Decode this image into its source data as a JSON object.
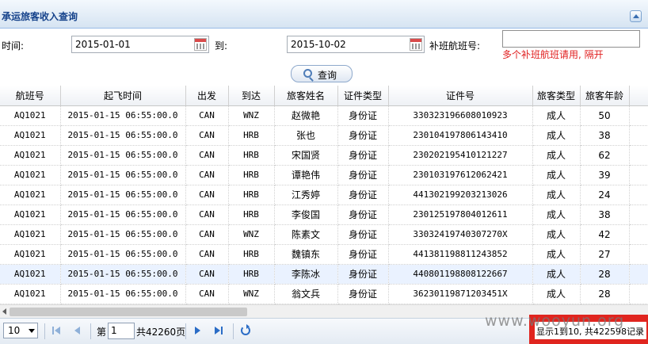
{
  "panel": {
    "title": "承运旅客收入查询"
  },
  "form": {
    "time_label": "时间:",
    "start_date": "2015-01-01",
    "to_label": "到:",
    "end_date": "2015-10-02",
    "supplement_label": "补班航班号:",
    "supplement_value": "",
    "hint": "多个补班航班请用, 隔开",
    "query_label": "查询"
  },
  "table": {
    "columns": [
      "航班号",
      "起飞时间",
      "出发",
      "到达",
      "旅客姓名",
      "证件类型",
      "证件号",
      "旅客类型",
      "旅客年龄"
    ],
    "rows": [
      [
        "AQ1021",
        "2015-01-15 06:55:00.0",
        "CAN",
        "WNZ",
        "赵微艳",
        "身份证",
        "330323196608010923",
        "成人",
        "50"
      ],
      [
        "AQ1021",
        "2015-01-15 06:55:00.0",
        "CAN",
        "HRB",
        "张也",
        "身份证",
        "230104197806143410",
        "成人",
        "38"
      ],
      [
        "AQ1021",
        "2015-01-15 06:55:00.0",
        "CAN",
        "HRB",
        "宋国贤",
        "身份证",
        "230202195410121227",
        "成人",
        "62"
      ],
      [
        "AQ1021",
        "2015-01-15 06:55:00.0",
        "CAN",
        "HRB",
        "谭艳伟",
        "身份证",
        "230103197612062421",
        "成人",
        "39"
      ],
      [
        "AQ1021",
        "2015-01-15 06:55:00.0",
        "CAN",
        "HRB",
        "江秀婷",
        "身份证",
        "441302199203213026",
        "成人",
        "24"
      ],
      [
        "AQ1021",
        "2015-01-15 06:55:00.0",
        "CAN",
        "HRB",
        "李俊国",
        "身份证",
        "230125197804012611",
        "成人",
        "38"
      ],
      [
        "AQ1021",
        "2015-01-15 06:55:00.0",
        "CAN",
        "WNZ",
        "陈素文",
        "身份证",
        "33032419740307270X",
        "成人",
        "42"
      ],
      [
        "AQ1021",
        "2015-01-15 06:55:00.0",
        "CAN",
        "HRB",
        "魏镇东",
        "身份证",
        "441381198811243852",
        "成人",
        "27"
      ],
      [
        "AQ1021",
        "2015-01-15 06:55:00.0",
        "CAN",
        "HRB",
        "李陈冰",
        "身份证",
        "440801198808122667",
        "成人",
        "28"
      ],
      [
        "AQ1021",
        "2015-01-15 06:55:00.0",
        "CAN",
        "WNZ",
        "翁文兵",
        "身份证",
        "36230119871203451X",
        "成人",
        "28"
      ]
    ]
  },
  "pager": {
    "page_size": "10",
    "page_prefix": "第",
    "current_page": "1",
    "page_total": "共42260页",
    "summary": "显示1到10, 共422598记录"
  },
  "watermark": "www.wooyun.org"
}
